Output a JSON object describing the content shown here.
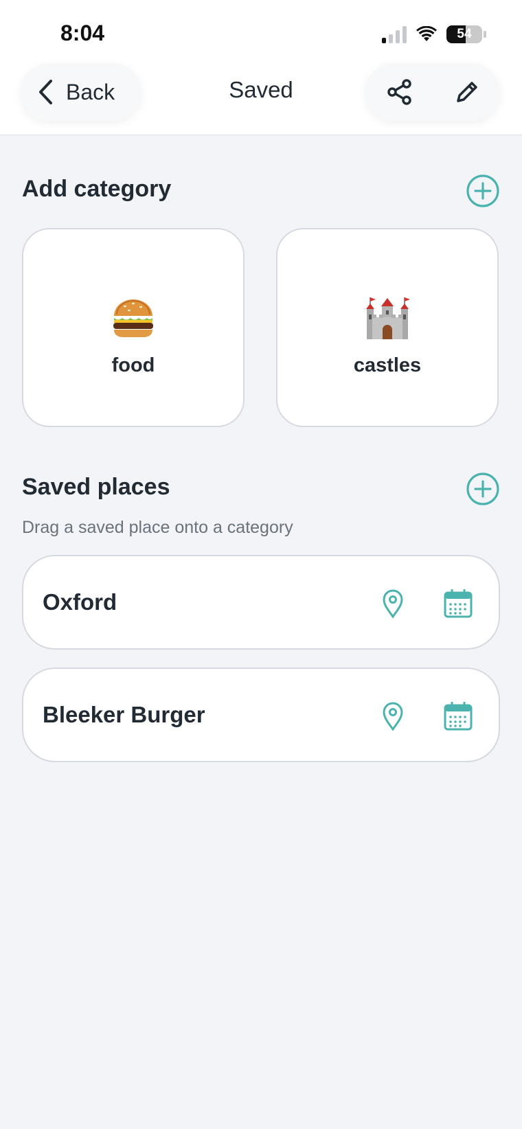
{
  "status_bar": {
    "time": "8:04",
    "battery": "54",
    "battery_level": 0.54
  },
  "nav": {
    "back_label": "Back",
    "title": "Saved"
  },
  "categories_section": {
    "title": "Add category",
    "items": [
      {
        "emoji_icon": "hamburger-icon",
        "label": "food"
      },
      {
        "emoji_icon": "castle-icon",
        "label": "castles"
      }
    ]
  },
  "places_section": {
    "title": "Saved places",
    "hint": "Drag a saved place onto a category",
    "items": [
      {
        "name": "Oxford"
      },
      {
        "name": "Bleeker Burger"
      }
    ]
  },
  "colors": {
    "accent": "#4bb3ad",
    "text": "#222b33",
    "background": "#f2f4f8"
  }
}
